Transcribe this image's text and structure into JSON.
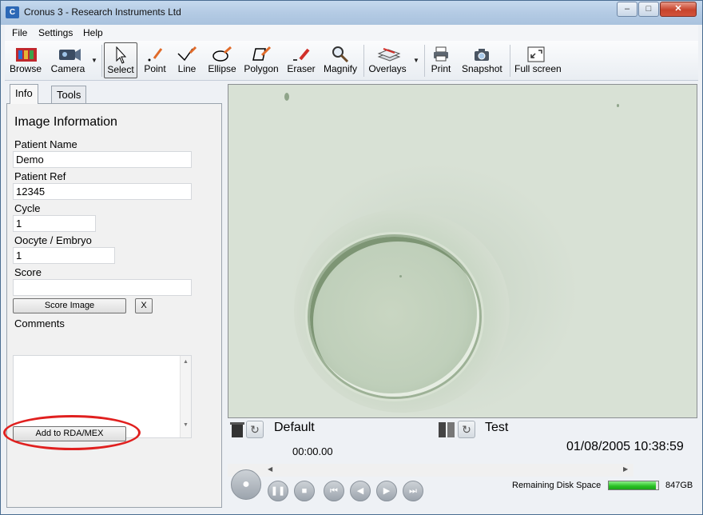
{
  "window": {
    "title": "Cronus 3 - Research Instruments Ltd",
    "icon": "app-icon",
    "min": "–",
    "max": "□",
    "close": "✕"
  },
  "menu": [
    "File",
    "Settings",
    "Help"
  ],
  "toolbar": {
    "tools": [
      {
        "label": "Browse",
        "icon": "film-stack-icon"
      },
      {
        "label": "Camera",
        "icon": "camera-icon"
      },
      {
        "label": "Select",
        "icon": "cursor-icon",
        "selected": true
      },
      {
        "label": "Point",
        "icon": "pencil-point-icon"
      },
      {
        "label": "Line",
        "icon": "pencil-line-icon"
      },
      {
        "label": "Ellipse",
        "icon": "pencil-ellipse-icon"
      },
      {
        "label": "Polygon",
        "icon": "pencil-polygon-icon"
      },
      {
        "label": "Eraser",
        "icon": "eraser-icon"
      },
      {
        "label": "Magnify",
        "icon": "magnifier-icon"
      },
      {
        "label": "Overlays",
        "icon": "overlays-icon"
      },
      {
        "label": "Print",
        "icon": "printer-icon"
      },
      {
        "label": "Snapshot",
        "icon": "snapshot-camera-icon"
      },
      {
        "label": "Full screen",
        "icon": "fullscreen-icon"
      }
    ]
  },
  "tabs": {
    "info": "Info",
    "tools": "Tools"
  },
  "info": {
    "heading": "Image Information",
    "patient_name_label": "Patient Name",
    "patient_name": "Demo",
    "patient_ref_label": "Patient Ref",
    "patient_ref": "12345",
    "cycle_label": "Cycle",
    "cycle": "1",
    "oocyte_label": "Oocyte / Embryo",
    "oocyte": "1",
    "score_label": "Score",
    "score": "",
    "score_button": "Score Image",
    "clear_button": "X",
    "comments_label": "Comments",
    "comments": "",
    "add_button": "Add to RDA/MEX"
  },
  "status": {
    "left_preset": "Default",
    "right_preset": "Test",
    "timer": "00:00.00",
    "datetime": "01/08/2005 10:38:59",
    "disk_label": "Remaining Disk Space",
    "disk_value": "847GB",
    "disk_fraction": 0.95
  },
  "colors": {
    "highlight_oval": "#e0201f",
    "disk_bar": "#27c022"
  }
}
